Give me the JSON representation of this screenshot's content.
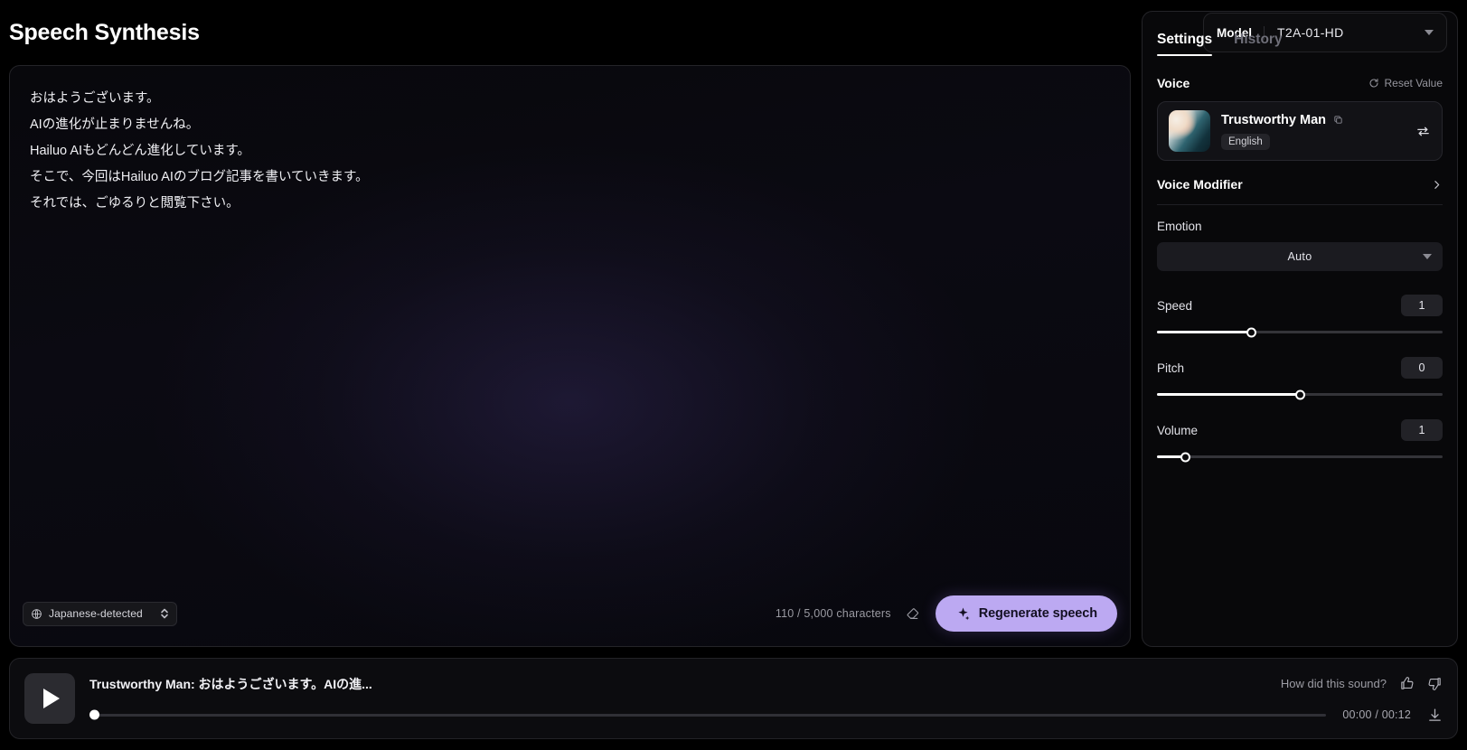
{
  "header": {
    "title": "Speech Synthesis",
    "model": {
      "label": "Model",
      "value": "T2A-01-HD",
      "caret_icon": "chevron-down-icon"
    }
  },
  "editor": {
    "lines": [
      "おはようございます。",
      "AIの進化が止まりませんね。",
      "Hailuo AIもどんどん進化しています。",
      "そこで、今回はHailuo AIのブログ記事を書いていきます。",
      "それでは、ごゆるりと閲覧下さい。"
    ],
    "language": {
      "value": "Japanese-detected",
      "globe_icon": "globe-icon",
      "stepper_icon": "up-down-chevron-icon"
    },
    "char_count": "110 / 5,000 characters",
    "clear_icon": "eraser-icon",
    "regenerate": {
      "label": "Regenerate speech",
      "icon": "sparkle-icon",
      "color": "#bca9f2"
    }
  },
  "sidebar": {
    "tabs": [
      {
        "label": "Settings",
        "active": true
      },
      {
        "label": "History",
        "active": false
      }
    ],
    "voice_section": {
      "title": "Voice",
      "reset": {
        "label": "Reset Value",
        "icon": "refresh-icon"
      },
      "card": {
        "name": "Trustworthy Man",
        "copy_icon": "copy-icon",
        "language_badge": "English",
        "swap_icon": "swap-icon",
        "avatar_icon": "voice-avatar"
      }
    },
    "voice_modifier": {
      "label": "Voice Modifier",
      "chevron_icon": "chevron-right-icon"
    },
    "emotion": {
      "label": "Emotion",
      "value": "Auto",
      "caret_icon": "chevron-down-icon"
    },
    "sliders": [
      {
        "label": "Speed",
        "value": "1",
        "percent": 33
      },
      {
        "label": "Pitch",
        "value": "0",
        "percent": 50
      },
      {
        "label": "Volume",
        "value": "1",
        "percent": 10
      }
    ]
  },
  "player": {
    "play_icon": "play-icon",
    "track_title": "Trustworthy Man: おはようございます。AIの進...",
    "feedback": {
      "label": "How did this sound?",
      "up_icon": "thumbs-up-icon",
      "down_icon": "thumbs-down-icon"
    },
    "progress_percent": 0,
    "time": "00:00 / 00:12",
    "download_icon": "download-icon"
  }
}
